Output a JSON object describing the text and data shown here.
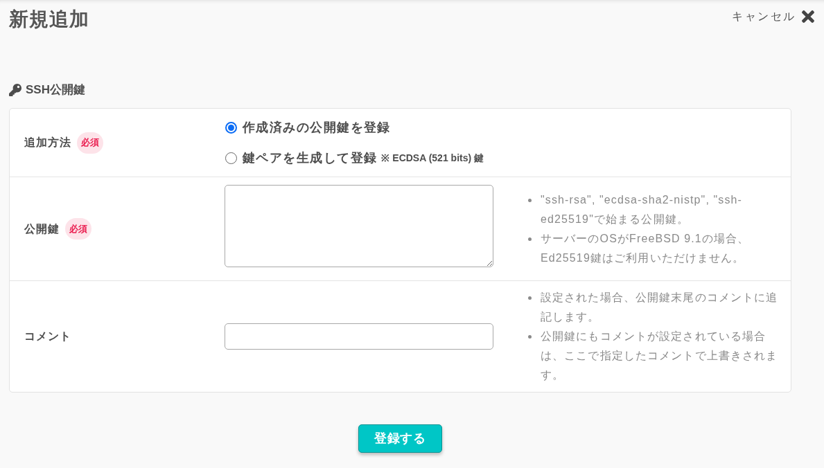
{
  "header": {
    "title": "新規追加",
    "cancel": "キャンセル"
  },
  "section": {
    "title": "SSH公開鍵"
  },
  "form": {
    "rows": [
      {
        "kind": "radio",
        "label": "追加方法",
        "required_badge": "必須",
        "options": [
          {
            "label": "作成済みの公開鍵を登録",
            "selected": true
          },
          {
            "label": "鍵ペアを生成して登録",
            "note": "※ ECDSA (521 bits) 鍵",
            "selected": false
          }
        ]
      },
      {
        "kind": "textarea",
        "label": "公開鍵",
        "required_badge": "必須",
        "hints": [
          "\"ssh-rsa\", \"ecdsa-sha2-nistp\", \"ssh-ed25519\"で始まる公開鍵。",
          "サーバーのOSがFreeBSD 9.1の場合、Ed25519鍵はご利用いただけません。"
        ]
      },
      {
        "kind": "input",
        "label": "コメント",
        "hints": [
          "設定された場合、公開鍵末尾のコメントに追記します。",
          "公開鍵にもコメントが設定されている場合は、ここで指定したコメントで上書きされます。"
        ]
      }
    ]
  },
  "submit": {
    "label": "登録する"
  }
}
